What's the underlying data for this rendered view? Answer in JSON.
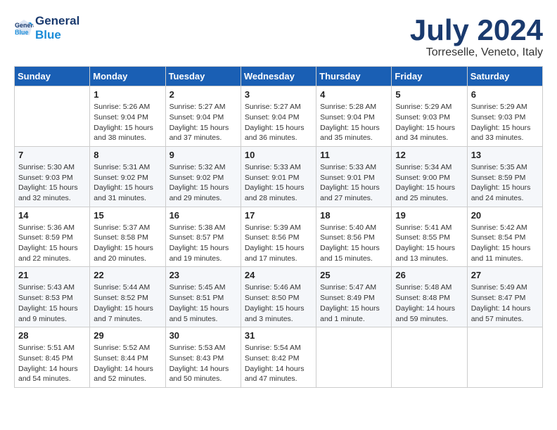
{
  "header": {
    "logo_line1": "General",
    "logo_line2": "Blue",
    "month": "July 2024",
    "location": "Torreselle, Veneto, Italy"
  },
  "weekdays": [
    "Sunday",
    "Monday",
    "Tuesday",
    "Wednesday",
    "Thursday",
    "Friday",
    "Saturday"
  ],
  "weeks": [
    [
      {
        "day": "",
        "info": ""
      },
      {
        "day": "1",
        "info": "Sunrise: 5:26 AM\nSunset: 9:04 PM\nDaylight: 15 hours\nand 38 minutes."
      },
      {
        "day": "2",
        "info": "Sunrise: 5:27 AM\nSunset: 9:04 PM\nDaylight: 15 hours\nand 37 minutes."
      },
      {
        "day": "3",
        "info": "Sunrise: 5:27 AM\nSunset: 9:04 PM\nDaylight: 15 hours\nand 36 minutes."
      },
      {
        "day": "4",
        "info": "Sunrise: 5:28 AM\nSunset: 9:04 PM\nDaylight: 15 hours\nand 35 minutes."
      },
      {
        "day": "5",
        "info": "Sunrise: 5:29 AM\nSunset: 9:03 PM\nDaylight: 15 hours\nand 34 minutes."
      },
      {
        "day": "6",
        "info": "Sunrise: 5:29 AM\nSunset: 9:03 PM\nDaylight: 15 hours\nand 33 minutes."
      }
    ],
    [
      {
        "day": "7",
        "info": "Sunrise: 5:30 AM\nSunset: 9:03 PM\nDaylight: 15 hours\nand 32 minutes."
      },
      {
        "day": "8",
        "info": "Sunrise: 5:31 AM\nSunset: 9:02 PM\nDaylight: 15 hours\nand 31 minutes."
      },
      {
        "day": "9",
        "info": "Sunrise: 5:32 AM\nSunset: 9:02 PM\nDaylight: 15 hours\nand 29 minutes."
      },
      {
        "day": "10",
        "info": "Sunrise: 5:33 AM\nSunset: 9:01 PM\nDaylight: 15 hours\nand 28 minutes."
      },
      {
        "day": "11",
        "info": "Sunrise: 5:33 AM\nSunset: 9:01 PM\nDaylight: 15 hours\nand 27 minutes."
      },
      {
        "day": "12",
        "info": "Sunrise: 5:34 AM\nSunset: 9:00 PM\nDaylight: 15 hours\nand 25 minutes."
      },
      {
        "day": "13",
        "info": "Sunrise: 5:35 AM\nSunset: 8:59 PM\nDaylight: 15 hours\nand 24 minutes."
      }
    ],
    [
      {
        "day": "14",
        "info": "Sunrise: 5:36 AM\nSunset: 8:59 PM\nDaylight: 15 hours\nand 22 minutes."
      },
      {
        "day": "15",
        "info": "Sunrise: 5:37 AM\nSunset: 8:58 PM\nDaylight: 15 hours\nand 20 minutes."
      },
      {
        "day": "16",
        "info": "Sunrise: 5:38 AM\nSunset: 8:57 PM\nDaylight: 15 hours\nand 19 minutes."
      },
      {
        "day": "17",
        "info": "Sunrise: 5:39 AM\nSunset: 8:56 PM\nDaylight: 15 hours\nand 17 minutes."
      },
      {
        "day": "18",
        "info": "Sunrise: 5:40 AM\nSunset: 8:56 PM\nDaylight: 15 hours\nand 15 minutes."
      },
      {
        "day": "19",
        "info": "Sunrise: 5:41 AM\nSunset: 8:55 PM\nDaylight: 15 hours\nand 13 minutes."
      },
      {
        "day": "20",
        "info": "Sunrise: 5:42 AM\nSunset: 8:54 PM\nDaylight: 15 hours\nand 11 minutes."
      }
    ],
    [
      {
        "day": "21",
        "info": "Sunrise: 5:43 AM\nSunset: 8:53 PM\nDaylight: 15 hours\nand 9 minutes."
      },
      {
        "day": "22",
        "info": "Sunrise: 5:44 AM\nSunset: 8:52 PM\nDaylight: 15 hours\nand 7 minutes."
      },
      {
        "day": "23",
        "info": "Sunrise: 5:45 AM\nSunset: 8:51 PM\nDaylight: 15 hours\nand 5 minutes."
      },
      {
        "day": "24",
        "info": "Sunrise: 5:46 AM\nSunset: 8:50 PM\nDaylight: 15 hours\nand 3 minutes."
      },
      {
        "day": "25",
        "info": "Sunrise: 5:47 AM\nSunset: 8:49 PM\nDaylight: 15 hours\nand 1 minute."
      },
      {
        "day": "26",
        "info": "Sunrise: 5:48 AM\nSunset: 8:48 PM\nDaylight: 14 hours\nand 59 minutes."
      },
      {
        "day": "27",
        "info": "Sunrise: 5:49 AM\nSunset: 8:47 PM\nDaylight: 14 hours\nand 57 minutes."
      }
    ],
    [
      {
        "day": "28",
        "info": "Sunrise: 5:51 AM\nSunset: 8:45 PM\nDaylight: 14 hours\nand 54 minutes."
      },
      {
        "day": "29",
        "info": "Sunrise: 5:52 AM\nSunset: 8:44 PM\nDaylight: 14 hours\nand 52 minutes."
      },
      {
        "day": "30",
        "info": "Sunrise: 5:53 AM\nSunset: 8:43 PM\nDaylight: 14 hours\nand 50 minutes."
      },
      {
        "day": "31",
        "info": "Sunrise: 5:54 AM\nSunset: 8:42 PM\nDaylight: 14 hours\nand 47 minutes."
      },
      {
        "day": "",
        "info": ""
      },
      {
        "day": "",
        "info": ""
      },
      {
        "day": "",
        "info": ""
      }
    ]
  ]
}
